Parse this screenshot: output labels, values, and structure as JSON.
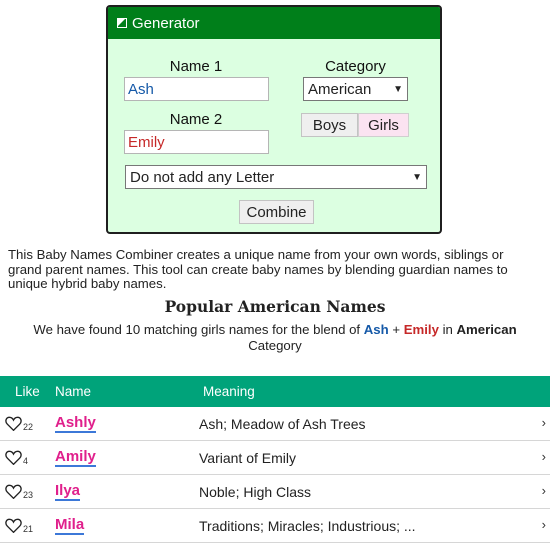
{
  "generator": {
    "title": "Generator",
    "name1_label": "Name 1",
    "name1_value": "Ash",
    "name2_label": "Name 2",
    "name2_value": "Emily",
    "category_label": "Category",
    "category_value": "American",
    "gender_boys": "Boys",
    "gender_girls": "Girls",
    "gender_selected": "Girls",
    "letter_option": "Do not add any Letter",
    "combine_label": "Combine",
    "colors": {
      "header": "#007f1a",
      "panel": "#dcffe1"
    }
  },
  "description": "This Baby Names Combiner creates a unique name from your own words, siblings or grand parent names. This tool can create baby names by blending guardian names to unique hybrid baby names.",
  "popular_title": "Popular American Names",
  "found": {
    "prefix": "We have found 10 matching girls names for the blend of",
    "name1": "Ash",
    "plus": "+",
    "name2": "Emily",
    "in": "in",
    "category": "American",
    "suffix": "Category"
  },
  "table": {
    "headers": {
      "like": "Like",
      "name": "Name",
      "meaning": "Meaning"
    },
    "header_color": "#00a37a",
    "rows": [
      {
        "likes": "22",
        "name": "Ashly",
        "meaning": "Ash; Meadow of Ash Trees"
      },
      {
        "likes": "4",
        "name": "Amily",
        "meaning": "Variant of Emily"
      },
      {
        "likes": "23",
        "name": "Ilya",
        "meaning": "Noble; High Class"
      },
      {
        "likes": "21",
        "name": "Mila",
        "meaning": "Traditions; Miracles; Industrious; ..."
      }
    ]
  }
}
